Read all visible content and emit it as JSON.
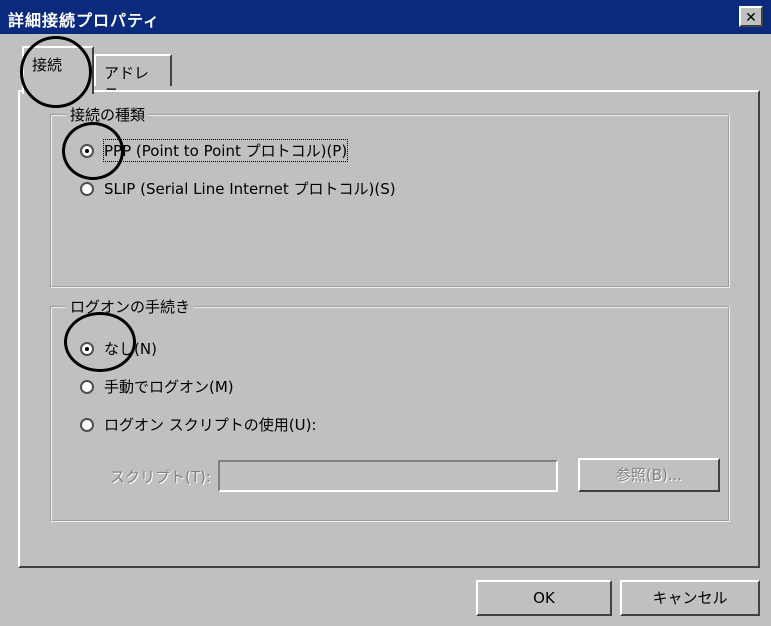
{
  "window": {
    "title": "詳細接続プロパティ",
    "close_glyph": "✕"
  },
  "tabs": [
    {
      "label": "接続",
      "selected": true
    },
    {
      "label": "アドレス",
      "selected": false
    }
  ],
  "connection_type": {
    "label": "接続の種類",
    "options": [
      {
        "label": "PPP (Point to Point プロトコル)(P)",
        "checked": true
      },
      {
        "label": "SLIP (Serial Line Internet プロトコル)(S)",
        "checked": false
      }
    ]
  },
  "logon": {
    "label": "ログオンの手続き",
    "options": [
      {
        "label": "なし(N)",
        "checked": true
      },
      {
        "label": "手動でログオン(M)",
        "checked": false
      },
      {
        "label": "ログオン スクリプトの使用(U):",
        "checked": false
      }
    ],
    "script_label": "スクリプト(T):",
    "script_value": "",
    "browse_label": "参照(B)..."
  },
  "footer": {
    "ok_label": "OK",
    "cancel_label": "キャンセル"
  }
}
